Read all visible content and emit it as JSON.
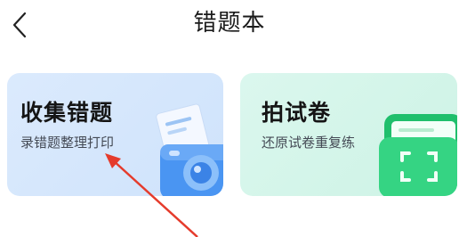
{
  "header": {
    "title": "错题本"
  },
  "cards": [
    {
      "title": "收集错题",
      "subtitle": "录错题整理打印"
    },
    {
      "title": "拍试卷",
      "subtitle": "还原试卷重复练"
    }
  ],
  "colors": {
    "blue_card": "#d6e7fc",
    "green_card": "#d4f5e9",
    "camera_blue": "#3f8ef0",
    "folder_green": "#2ccf7a",
    "annotation_arrow": "#e53b2c"
  }
}
